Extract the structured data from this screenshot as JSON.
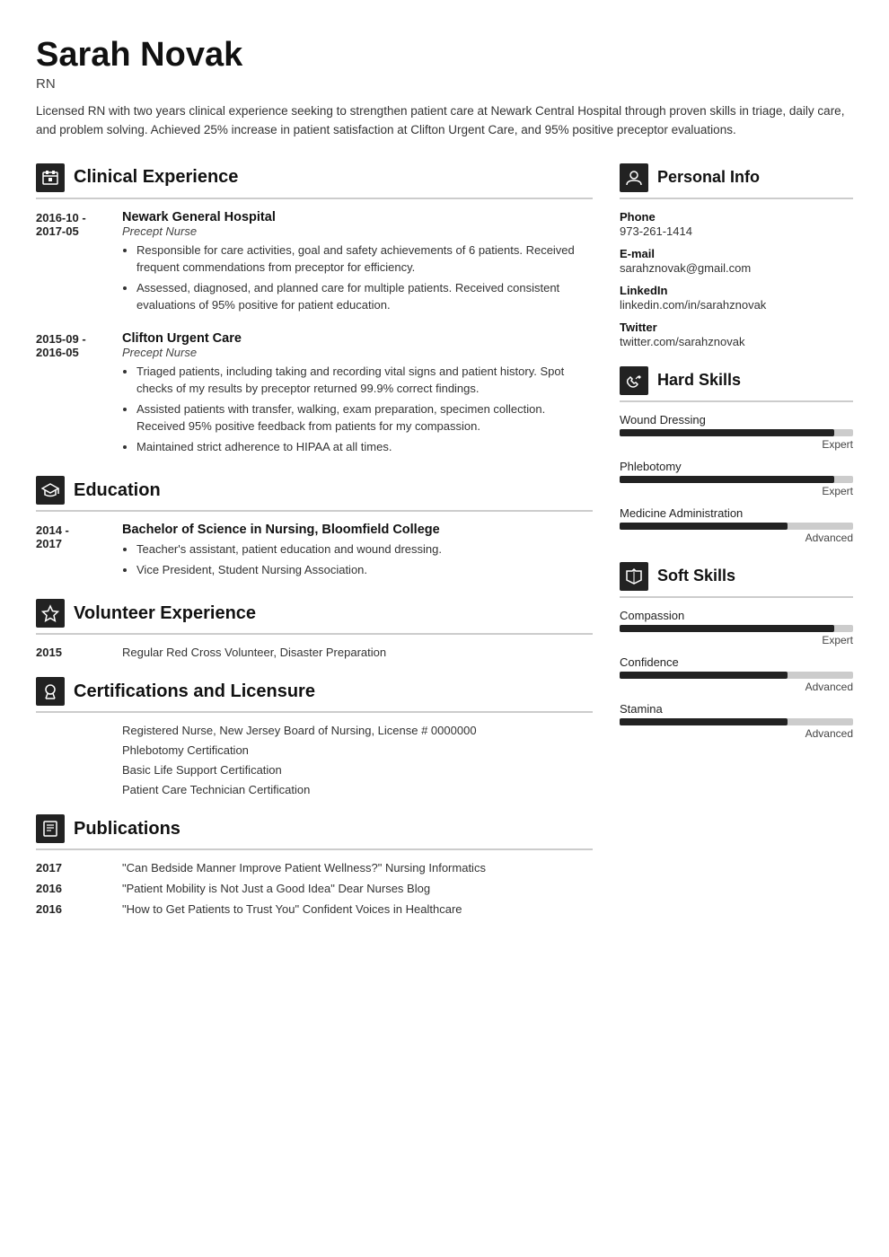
{
  "header": {
    "name": "Sarah Novak",
    "title": "RN",
    "summary": "Licensed RN with two years clinical experience seeking to strengthen patient care at Newark Central Hospital through proven skills in triage, daily care, and problem solving. Achieved 25% increase in patient satisfaction at Clifton Urgent Care, and 95% positive preceptor evaluations."
  },
  "sections": {
    "clinical_experience": {
      "title": "Clinical Experience",
      "entries": [
        {
          "date": "2016-10 -\n2017-05",
          "company": "Newark General Hospital",
          "role": "Precept Nurse",
          "bullets": [
            "Responsible for care activities, goal and safety achievements of 6 patients. Received frequent commendations from preceptor for efficiency.",
            "Assessed, diagnosed, and planned care for multiple patients. Received consistent evaluations of 95% positive for patient education."
          ]
        },
        {
          "date": "2015-09 -\n2016-05",
          "company": "Clifton Urgent Care",
          "role": "Precept Nurse",
          "bullets": [
            "Triaged patients, including taking and recording vital signs and patient history. Spot checks of my results by preceptor returned 99.9% correct findings.",
            "Assisted patients with transfer, walking, exam preparation, specimen collection. Received 95% positive feedback from patients for my compassion.",
            "Maintained strict adherence to HIPAA at all times."
          ]
        }
      ]
    },
    "education": {
      "title": "Education",
      "entries": [
        {
          "date": "2014 -\n2017",
          "company": "Bachelor of Science in Nursing, Bloomfield College",
          "role": "",
          "bullets": [
            "Teacher's assistant, patient education and wound dressing.",
            "Vice President, Student Nursing Association."
          ]
        }
      ]
    },
    "volunteer": {
      "title": "Volunteer Experience",
      "entries": [
        {
          "date": "2015",
          "text": "Regular Red Cross Volunteer, Disaster Preparation"
        }
      ]
    },
    "certifications": {
      "title": "Certifications and Licensure",
      "items": [
        "Registered Nurse, New Jersey Board of Nursing, License # 0000000",
        "Phlebotomy Certification",
        "Basic Life Support Certification",
        "Patient Care Technician Certification"
      ]
    },
    "publications": {
      "title": "Publications",
      "entries": [
        {
          "date": "2017",
          "text": "\"Can Bedside Manner Improve Patient Wellness?\" Nursing Informatics"
        },
        {
          "date": "2016",
          "text": "\"Patient Mobility is Not Just a Good Idea\" Dear Nurses Blog"
        },
        {
          "date": "2016",
          "text": "\"How to Get Patients to Trust You\" Confident Voices in Healthcare"
        }
      ]
    }
  },
  "right": {
    "personal_info": {
      "title": "Personal Info",
      "fields": [
        {
          "label": "Phone",
          "value": "973-261-1414"
        },
        {
          "label": "E-mail",
          "value": "sarahznovak@gmail.com"
        },
        {
          "label": "LinkedIn",
          "value": "linkedin.com/in/sarahznovak"
        },
        {
          "label": "Twitter",
          "value": "twitter.com/sarahznovak"
        }
      ]
    },
    "hard_skills": {
      "title": "Hard Skills",
      "skills": [
        {
          "name": "Wound Dressing",
          "level": "Expert",
          "percent": 92
        },
        {
          "name": "Phlebotomy",
          "level": "Expert",
          "percent": 92
        },
        {
          "name": "Medicine Administration",
          "level": "Advanced",
          "percent": 72
        }
      ]
    },
    "soft_skills": {
      "title": "Soft Skills",
      "skills": [
        {
          "name": "Compassion",
          "level": "Expert",
          "percent": 92
        },
        {
          "name": "Confidence",
          "level": "Advanced",
          "percent": 72
        },
        {
          "name": "Stamina",
          "level": "Advanced",
          "percent": 72
        }
      ]
    }
  },
  "icons": {
    "clinical": "🏥",
    "education": "🎓",
    "volunteer": "⭐",
    "certifications": "🏅",
    "publications": "📋",
    "personal": "👤",
    "hard_skills": "🔧",
    "soft_skills": "🚩"
  }
}
